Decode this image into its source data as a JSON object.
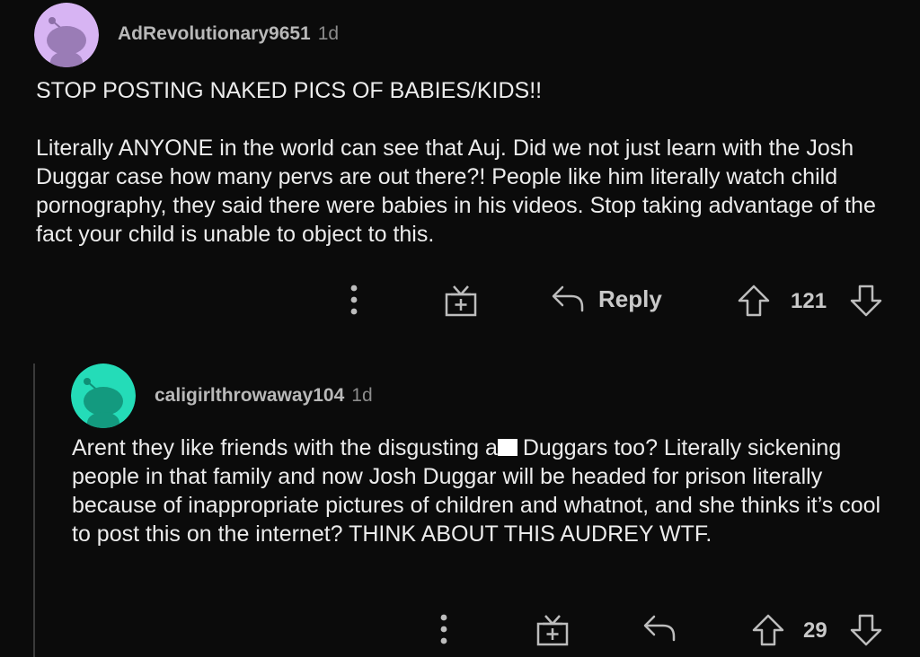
{
  "comments": [
    {
      "username": "AdRevolutionary9651",
      "age": "1d",
      "avatar_color": "#d7b4f3",
      "paragraphs": [
        "STOP POSTING NAKED PICS OF BABIES/KIDS!!",
        "Literally ANYONE in the world can see that Auj. Did we not just learn with the Josh Duggar case how many pervs are out there?! People like him literally watch child pornography, they said there were babies in his videos. Stop taking advantage of the fact your child is unable to object to this."
      ],
      "reply_label": "Reply",
      "votes": "121"
    },
    {
      "username": "caligirlthrowaway104",
      "age": "1d",
      "avatar_color": "#24dcb8",
      "text_before_redaction": "Arent they like friends with the disgusting a",
      "text_after_redaction": "Duggars too? Literally sickening people in that family and now Josh Duggar will be headed for prison literally because of inappropriate pictures of children and whatnot, and she thinks it’s cool to post this on the internet? THINK ABOUT THIS AUDREY WTF.",
      "votes": "29"
    }
  ],
  "icons": {
    "more": "more-options-icon",
    "award": "award-gift-icon",
    "reply": "reply-arrow-icon",
    "upvote": "upvote-arrow-icon",
    "downvote": "downvote-arrow-icon"
  },
  "colors": {
    "background": "#0b0b0b",
    "text": "#ececec",
    "muted": "#8c8c8c"
  }
}
